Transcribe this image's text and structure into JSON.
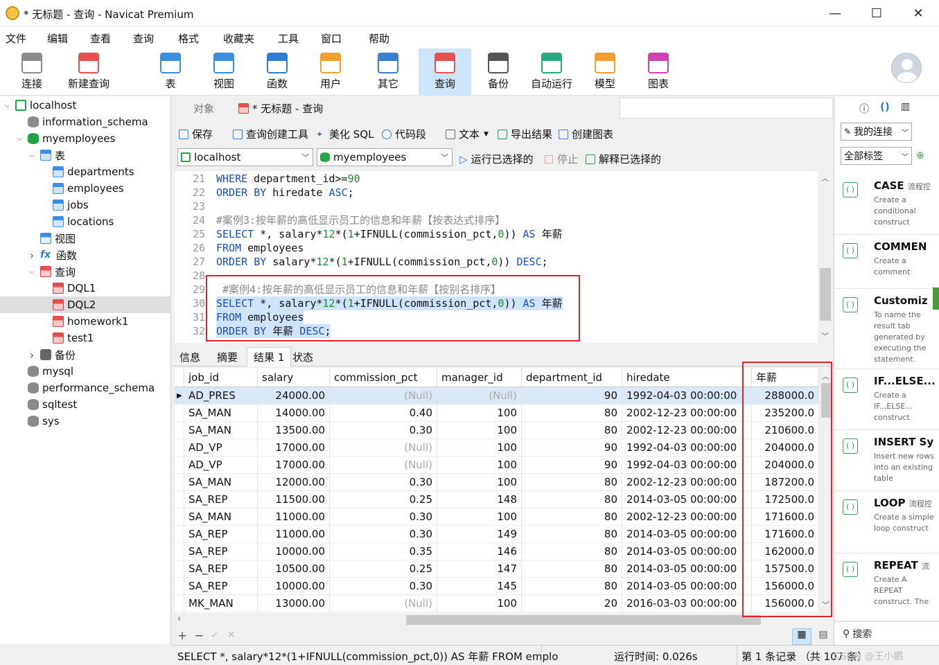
{
  "window": {
    "title": "* 无标题 - 查询 - Navicat Premium",
    "minimize": "—",
    "maximize": "☐",
    "close": "✕"
  },
  "menu": [
    "文件",
    "编辑",
    "查看",
    "查询",
    "格式",
    "收藏夹",
    "工具",
    "窗口",
    "帮助"
  ],
  "toolbar": [
    {
      "label": "连接",
      "color": "#8c8c8c"
    },
    {
      "label": "新建查询",
      "color": "#e85050"
    },
    {
      "label": "表",
      "color": "#3a8fe0"
    },
    {
      "label": "视图",
      "color": "#3a8fe0"
    },
    {
      "label": "函数",
      "color": "#2d7fd3"
    },
    {
      "label": "用户",
      "color": "#f0a030"
    },
    {
      "label": "其它",
      "color": "#3a7fd0"
    },
    {
      "label": "查询",
      "color": "#e85050"
    },
    {
      "label": "备份",
      "color": "#555555"
    },
    {
      "label": "自动运行",
      "color": "#2aa880"
    },
    {
      "label": "模型",
      "color": "#f0a030"
    },
    {
      "label": "图表",
      "color": "#d040b0"
    }
  ],
  "sidebar": [
    {
      "label": "localhost",
      "arrow": "v",
      "icon": "host"
    },
    {
      "label": "information_schema",
      "arrow": "",
      "icon": "db"
    },
    {
      "label": "myemployees",
      "arrow": "v",
      "icon": "dbg"
    },
    {
      "label": "表",
      "arrow": "v",
      "icon": "tbl"
    },
    {
      "label": "departments",
      "arrow": "",
      "icon": "tbl"
    },
    {
      "label": "employees",
      "arrow": "",
      "icon": "tbl"
    },
    {
      "label": "jobs",
      "arrow": "",
      "icon": "tbl"
    },
    {
      "label": "locations",
      "arrow": "",
      "icon": "tbl"
    },
    {
      "label": "视图",
      "arrow": "",
      "icon": "view"
    },
    {
      "label": "函数",
      "arrow": ">",
      "icon": "fx"
    },
    {
      "label": "查询",
      "arrow": "v",
      "icon": "q"
    },
    {
      "label": "DQL1",
      "arrow": "",
      "icon": "q"
    },
    {
      "label": "DQL2",
      "arrow": "",
      "icon": "q"
    },
    {
      "label": "homework1",
      "arrow": "",
      "icon": "q"
    },
    {
      "label": "test1",
      "arrow": "",
      "icon": "q"
    },
    {
      "label": "备份",
      "arrow": ">",
      "icon": "bk"
    },
    {
      "label": "mysql",
      "arrow": "",
      "icon": "db"
    },
    {
      "label": "performance_schema",
      "arrow": "",
      "icon": "db"
    },
    {
      "label": "sqltest",
      "arrow": "",
      "icon": "db"
    },
    {
      "label": "sys",
      "arrow": "",
      "icon": "db"
    }
  ],
  "tabs": {
    "objects": "对象",
    "query": "* 无标题 - 查询"
  },
  "query_toolbar": {
    "save": "保存",
    "builder": "查询创建工具",
    "beautify": "美化 SQL",
    "snippet": "代码段",
    "text": "文本",
    "export": "导出结果",
    "chart": "创建图表"
  },
  "run_bar": {
    "connection": "localhost",
    "database": "myemployees",
    "run": "运行已选择的",
    "stop": "停止",
    "explain": "解释已选择的"
  },
  "editor_lines": [
    {
      "n": "21",
      "text": "WHERE department_id>=90"
    },
    {
      "n": "22",
      "text": "ORDER BY hiredate ASC;"
    },
    {
      "n": "23",
      "text": ""
    },
    {
      "n": "24",
      "text": "#案例3:按年薪的高低显示员工的信息和年薪【按表达式排序】"
    },
    {
      "n": "25",
      "text": "SELECT *, salary*12*(1+IFNULL(commission_pct,0)) AS 年薪"
    },
    {
      "n": "26",
      "text": "FROM employees"
    },
    {
      "n": "27",
      "text": "ORDER BY salary*12*(1+IFNULL(commission_pct,0)) DESC;"
    },
    {
      "n": "28",
      "text": ""
    },
    {
      "n": "29",
      "text": " #案例4:按年薪的高低显示员工的信息和年薪【按别名排序】"
    },
    {
      "n": "30",
      "text": "SELECT *, salary*12*(1+IFNULL(commission_pct,0)) AS 年薪"
    },
    {
      "n": "31",
      "text": "FROM employees"
    },
    {
      "n": "32",
      "text": "ORDER BY 年薪 DESC;"
    }
  ],
  "result_tabs": [
    "信息",
    "摘要",
    "结果 1",
    "状态"
  ],
  "grid": {
    "columns": [
      "job_id",
      "salary",
      "commission_pct",
      "manager_id",
      "department_id",
      "hiredate",
      "年薪"
    ],
    "rows": [
      [
        "AD_PRES",
        "24000.00",
        "(Null)",
        "(Null)",
        "90",
        "1992-04-03 00:00:00",
        "288000.0"
      ],
      [
        "SA_MAN",
        "14000.00",
        "0.40",
        "100",
        "80",
        "2002-12-23 00:00:00",
        "235200.0"
      ],
      [
        "SA_MAN",
        "13500.00",
        "0.30",
        "100",
        "80",
        "2002-12-23 00:00:00",
        "210600.0"
      ],
      [
        "AD_VP",
        "17000.00",
        "(Null)",
        "100",
        "90",
        "1992-04-03 00:00:00",
        "204000.0"
      ],
      [
        "AD_VP",
        "17000.00",
        "(Null)",
        "100",
        "90",
        "1992-04-03 00:00:00",
        "204000.0"
      ],
      [
        "SA_MAN",
        "12000.00",
        "0.30",
        "100",
        "80",
        "2002-12-23 00:00:00",
        "187200.0"
      ],
      [
        "SA_REP",
        "11500.00",
        "0.25",
        "148",
        "80",
        "2014-03-05 00:00:00",
        "172500.0"
      ],
      [
        "SA_MAN",
        "11000.00",
        "0.30",
        "100",
        "80",
        "2002-12-23 00:00:00",
        "171600.0"
      ],
      [
        "SA_REP",
        "11000.00",
        "0.30",
        "149",
        "80",
        "2014-03-05 00:00:00",
        "171600.0"
      ],
      [
        "SA_REP",
        "10000.00",
        "0.35",
        "146",
        "80",
        "2014-03-05 00:00:00",
        "162000.0"
      ],
      [
        "SA_REP",
        "10500.00",
        "0.25",
        "147",
        "80",
        "2014-03-05 00:00:00",
        "157500.0"
      ],
      [
        "SA_REP",
        "10000.00",
        "0.30",
        "145",
        "80",
        "2014-03-05 00:00:00",
        "156000.0"
      ],
      [
        "MK_MAN",
        "13000.00",
        "(Null)",
        "100",
        "20",
        "2016-03-03 00:00:00",
        "156000.0"
      ]
    ]
  },
  "status": {
    "sql": "SELECT *, salary*12*(1+IFNULL(commission_pct,0)) AS 年薪 FROM emplo",
    "time": "运行时间: 0.026s",
    "records": "第 1 条记录 （共 107 条）",
    "watermark": "CSDN @王小鹏"
  },
  "right_panel": {
    "conn_select": "我的连接",
    "tag_select": "全部标签",
    "search": "搜索",
    "snippets": [
      {
        "name": "CASE",
        "tag": "流程控",
        "desc": "Create a conditional construct"
      },
      {
        "name": "COMMEN",
        "tag": "",
        "desc": "Create a comment"
      },
      {
        "name": "Customiz",
        "tag": "",
        "desc": "To name the result tab generated by executing the statement."
      },
      {
        "name": "IF...ELSE...",
        "tag": "",
        "desc": "Create a IF...ELSE... construct"
      },
      {
        "name": "INSERT Sy",
        "tag": "",
        "desc": "Insert new rows into an existing table"
      },
      {
        "name": "LOOP",
        "tag": "流程控",
        "desc": "Create a simple loop construct"
      },
      {
        "name": "REPEAT",
        "tag": "流",
        "desc": "Create A REPEAT construct. The"
      }
    ]
  }
}
